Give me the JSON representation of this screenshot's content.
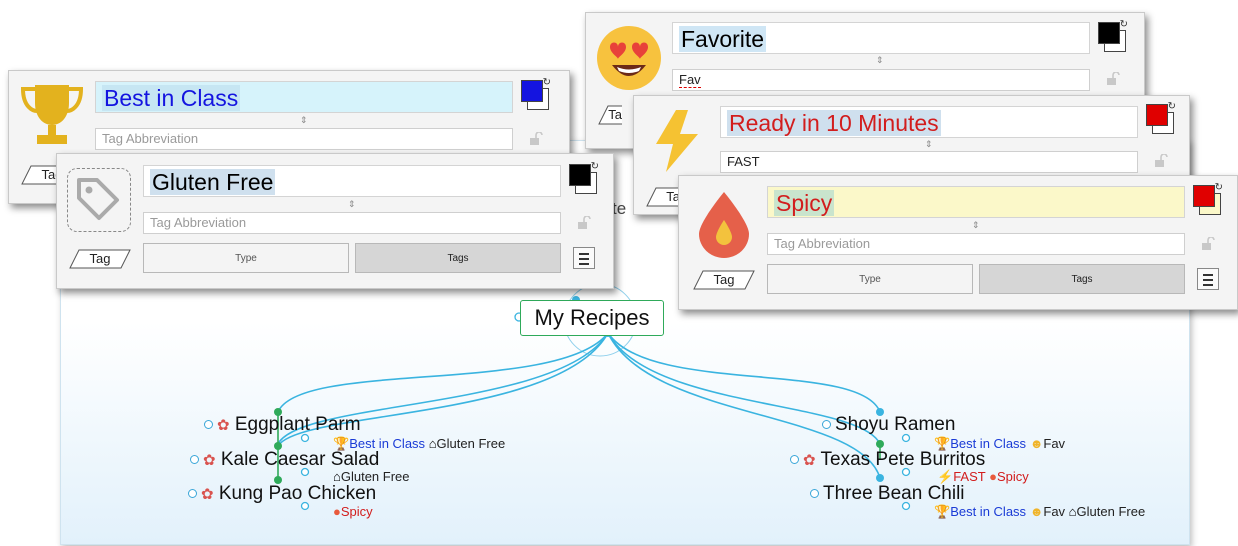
{
  "mindmap": {
    "root": "My Recipes",
    "left_nodes": [
      {
        "label": "Eggplant Parm",
        "tags": [
          {
            "icon": "trophy-icon",
            "text": "Best in Class"
          },
          {
            "icon": "tag-icon",
            "text": "Gluten Free"
          }
        ]
      },
      {
        "label": "Kale Caesar Salad",
        "tags": [
          {
            "icon": "tag-icon",
            "text": "Gluten Free"
          }
        ]
      },
      {
        "label": "Kung Pao Chicken",
        "tags": [
          {
            "icon": "drop-icon",
            "text": "Spicy"
          }
        ]
      }
    ],
    "right_nodes": [
      {
        "label": "Shoyu Ramen",
        "tags": [
          {
            "icon": "trophy-icon",
            "text": "Best in Class"
          },
          {
            "icon": "heart-eyes-icon",
            "text": "Fav"
          }
        ]
      },
      {
        "label": "Texas Pete Burritos",
        "tags": [
          {
            "icon": "lightning-icon",
            "text": "FAST"
          },
          {
            "icon": "drop-icon",
            "text": "Spicy"
          }
        ]
      },
      {
        "label": "Three Bean Chili",
        "tags": [
          {
            "icon": "trophy-icon",
            "text": "Best in Class"
          },
          {
            "icon": "heart-eyes-icon",
            "text": "Fav"
          },
          {
            "icon": "tag-icon",
            "text": "Gluten Free"
          }
        ]
      }
    ],
    "partial_text": "te"
  },
  "panels": {
    "best_in_class": {
      "title": "Best in Class",
      "abbr_placeholder": "Tag Abbreviation",
      "color": "#1414e0",
      "title_bg": "#d6f3fb",
      "icon": "trophy-icon",
      "tag_button": "Tag"
    },
    "gluten_free": {
      "title": "Gluten Free",
      "abbr_placeholder": "Tag Abbreviation",
      "color": "#000000",
      "icon": "tag-icon",
      "tag_button": "Tag",
      "type_label": "Type",
      "tags_label": "Tags"
    },
    "favorite": {
      "title": "Favorite",
      "abbr_value": "Fav",
      "color": "#000000",
      "icon": "heart-eyes-icon",
      "tag_button": "Tag"
    },
    "ready": {
      "title": "Ready in 10 Minutes",
      "abbr_value": "FAST",
      "color": "#e00000",
      "icon": "lightning-icon",
      "tag_button": "Tag"
    },
    "spicy": {
      "title": "Spicy",
      "abbr_placeholder": "Tag Abbreviation",
      "color": "#e00000",
      "title_bg": "#fbf8c9",
      "icon": "drop-icon",
      "tag_button": "Tag",
      "type_label": "Type",
      "tags_label": "Tags"
    }
  },
  "colors": {
    "link": "#3ab4e0",
    "green": "#2faa5a",
    "blue_text": "#1a3bd6",
    "red_text": "#d21d1d"
  }
}
